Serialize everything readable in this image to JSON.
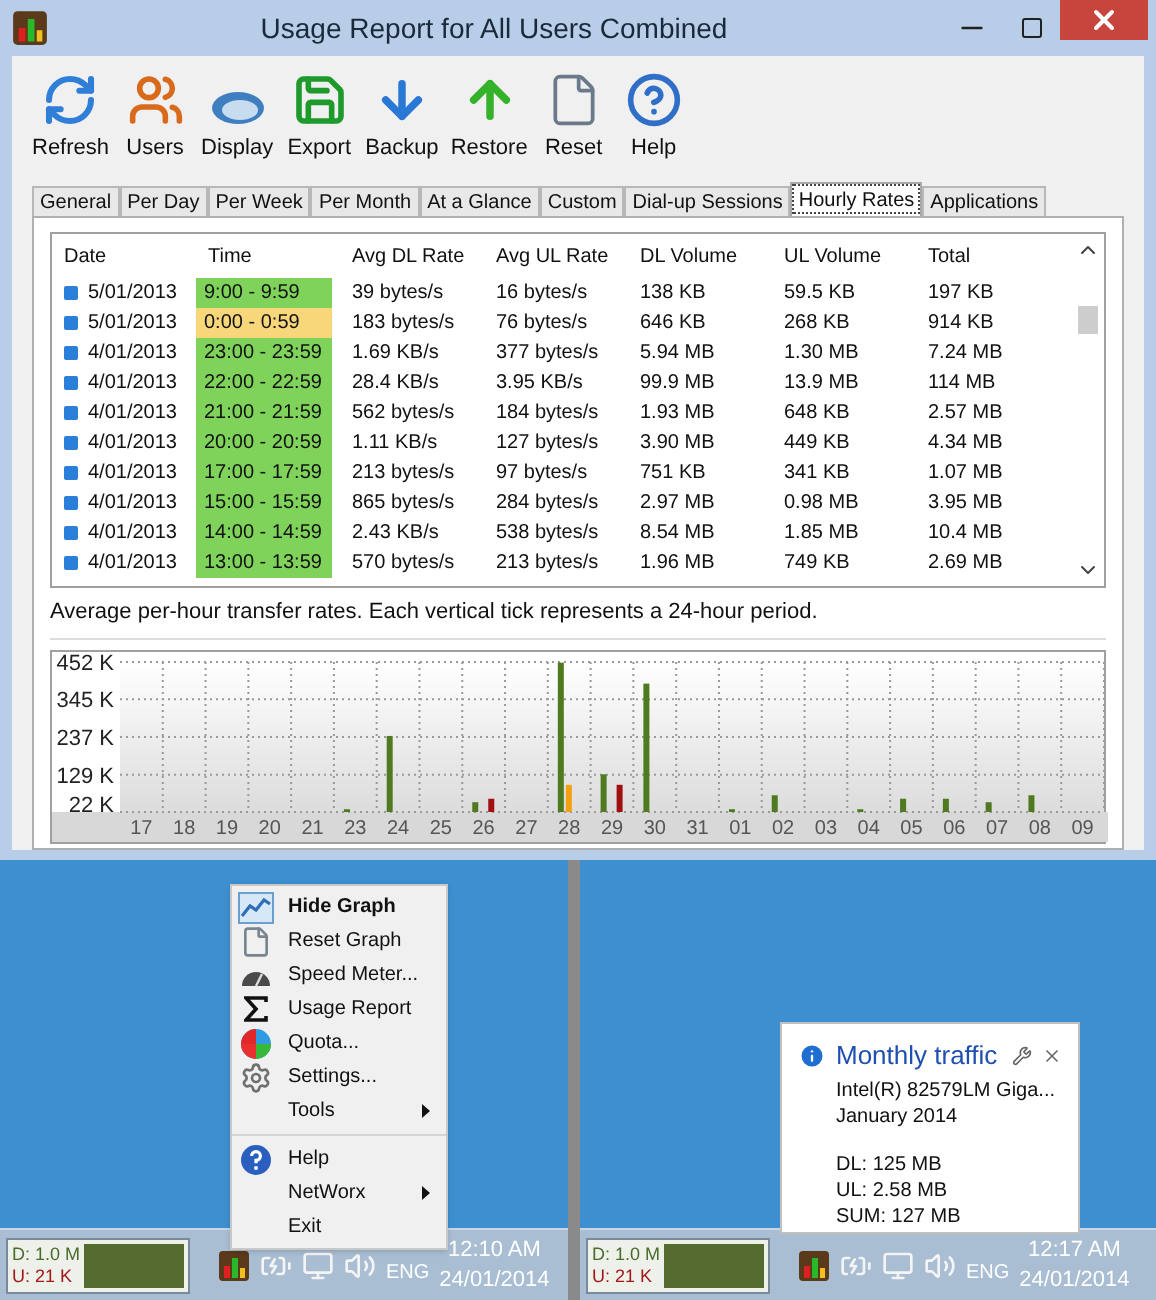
{
  "window": {
    "title": "Usage Report for All Users Combined"
  },
  "toolbar": [
    {
      "kind": "refresh",
      "label": "Refresh"
    },
    {
      "kind": "users",
      "label": "Users"
    },
    {
      "kind": "display",
      "label": "Display"
    },
    {
      "kind": "export",
      "label": "Export"
    },
    {
      "kind": "backup",
      "label": "Backup"
    },
    {
      "kind": "restore",
      "label": "Restore"
    },
    {
      "kind": "reset",
      "label": "Reset"
    },
    {
      "kind": "help",
      "label": "Help"
    }
  ],
  "tabs": [
    {
      "label": "General",
      "selected": false
    },
    {
      "label": "Per Day",
      "selected": false
    },
    {
      "label": "Per Week",
      "selected": false
    },
    {
      "label": "Per Month",
      "selected": false
    },
    {
      "label": "At a Glance",
      "selected": false
    },
    {
      "label": "Custom",
      "selected": false
    },
    {
      "label": "Dial-up Sessions",
      "selected": false
    },
    {
      "label": "Hourly Rates",
      "selected": true
    },
    {
      "label": "Applications",
      "selected": false
    }
  ],
  "table": {
    "columns": [
      "Date",
      "Time",
      "Avg DL Rate",
      "Avg UL Rate",
      "DL Volume",
      "UL Volume",
      "Total"
    ],
    "rows": [
      {
        "color": "#7fd35a",
        "cells": [
          "5/01/2013",
          "9:00 - 9:59",
          "39 bytes/s",
          "16 bytes/s",
          "138 KB",
          "59.5 KB",
          "197 KB"
        ]
      },
      {
        "color": "#f7d77a",
        "cells": [
          "5/01/2013",
          "0:00 - 0:59",
          "183 bytes/s",
          "76 bytes/s",
          "646 KB",
          "268 KB",
          "914 KB"
        ]
      },
      {
        "color": "#7fd35a",
        "cells": [
          "4/01/2013",
          "23:00 - 23:59",
          "1.69 KB/s",
          "377 bytes/s",
          "5.94 MB",
          "1.30 MB",
          "7.24 MB"
        ]
      },
      {
        "color": "#7fd35a",
        "cells": [
          "4/01/2013",
          "22:00 - 22:59",
          "28.4 KB/s",
          "3.95 KB/s",
          "99.9 MB",
          "13.9 MB",
          "114 MB"
        ]
      },
      {
        "color": "#7fd35a",
        "cells": [
          "4/01/2013",
          "21:00 - 21:59",
          "562 bytes/s",
          "184 bytes/s",
          "1.93 MB",
          "648 KB",
          "2.57 MB"
        ]
      },
      {
        "color": "#7fd35a",
        "cells": [
          "4/01/2013",
          "20:00 - 20:59",
          "1.11 KB/s",
          "127 bytes/s",
          "3.90 MB",
          "449 KB",
          "4.34 MB"
        ]
      },
      {
        "color": "#7fd35a",
        "cells": [
          "4/01/2013",
          "17:00 - 17:59",
          "213 bytes/s",
          "97 bytes/s",
          "751 KB",
          "341 KB",
          "1.07 MB"
        ]
      },
      {
        "color": "#7fd35a",
        "cells": [
          "4/01/2013",
          "15:00 - 15:59",
          "865 bytes/s",
          "284 bytes/s",
          "2.97 MB",
          "0.98 MB",
          "3.95 MB"
        ]
      },
      {
        "color": "#7fd35a",
        "cells": [
          "4/01/2013",
          "14:00 - 14:59",
          "2.43 KB/s",
          "538 bytes/s",
          "8.54 MB",
          "1.85 MB",
          "10.4 MB"
        ]
      },
      {
        "color": "#7fd35a",
        "cells": [
          "4/01/2013",
          "13:00 - 13:59",
          "570 bytes/s",
          "213 bytes/s",
          "1.96 MB",
          "749 KB",
          "2.69 MB"
        ]
      }
    ]
  },
  "graph": {
    "caption": "Average per-hour transfer rates. Each vertical tick represents a 24-hour period.",
    "chart_data": {
      "type": "bar",
      "categories": [
        "17",
        "18",
        "19",
        "20",
        "21",
        "23",
        "24",
        "25",
        "26",
        "27",
        "28",
        "29",
        "30",
        "31",
        "01",
        "02",
        "03",
        "04",
        "05",
        "06",
        "07",
        "08",
        "09"
      ],
      "grid": true,
      "series": [
        {
          "color": "#4f7a1f",
          "values": [
            null,
            null,
            null,
            null,
            null,
            30,
            240,
            null,
            50,
            null,
            450,
            130,
            390,
            null,
            30,
            70,
            null,
            30,
            60,
            60,
            50,
            70,
            null
          ]
        },
        {
          "color": "#f5a012",
          "values": [
            null,
            null,
            null,
            null,
            null,
            null,
            null,
            null,
            null,
            null,
            100,
            null,
            null,
            null,
            null,
            null,
            null,
            null,
            null,
            null,
            null,
            null,
            null
          ]
        },
        {
          "color": "#a01010",
          "values": [
            null,
            null,
            null,
            null,
            null,
            null,
            null,
            null,
            60,
            null,
            null,
            100,
            null,
            null,
            null,
            null,
            null,
            null,
            null,
            null,
            null,
            null,
            null
          ]
        }
      ],
      "ylim": [
        22,
        452
      ],
      "yticks": [
        {
          "value": 452,
          "label": "452 K"
        },
        {
          "value": 345,
          "label": "345 K"
        },
        {
          "value": 237,
          "label": "237 K"
        },
        {
          "value": 129,
          "label": "129 K"
        },
        {
          "value": 22,
          "label": "22 K"
        }
      ]
    }
  },
  "context_menu": {
    "groups": [
      [
        {
          "kind": "graph",
          "label": "Hide Graph",
          "bold": true,
          "submenu": false
        },
        {
          "kind": "page",
          "label": "Reset Graph",
          "bold": false,
          "submenu": false
        },
        {
          "kind": "meter",
          "label": "Speed Meter...",
          "bold": false,
          "submenu": false
        },
        {
          "kind": "sigma",
          "label": "Usage Report",
          "bold": false,
          "submenu": false
        },
        {
          "kind": "pie",
          "label": "Quota...",
          "bold": false,
          "submenu": false
        },
        {
          "kind": "settings",
          "label": "Settings...",
          "bold": false,
          "submenu": false
        },
        {
          "kind": "none",
          "label": "Tools",
          "bold": false,
          "submenu": true
        }
      ],
      [
        {
          "kind": "help",
          "label": "Help",
          "bold": false,
          "submenu": false
        },
        {
          "kind": "none",
          "label": "NetWorx",
          "bold": false,
          "submenu": true
        },
        {
          "kind": "none",
          "label": "Exit",
          "bold": false,
          "submenu": false
        }
      ]
    ]
  },
  "balloon": {
    "title": "Monthly traffic",
    "lines": [
      "Intel(R) 82579LM Giga...",
      "January 2014"
    ],
    "totals": [
      "DL: 125 MB",
      "UL: 2.58 MB",
      "SUM: 127 MB"
    ]
  },
  "taskbars": [
    {
      "download": "D: 1.0 M",
      "upload": "U: 21 K",
      "language": "ENG",
      "time": "12:10 AM",
      "date": "24/01/2014"
    },
    {
      "download": "D: 1.0 M",
      "upload": "U: 21 K",
      "language": "ENG",
      "time": "12:17 AM",
      "date": "24/01/2014"
    }
  ]
}
